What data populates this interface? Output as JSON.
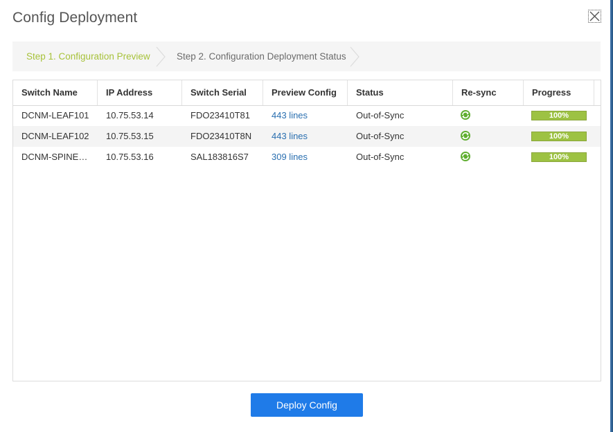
{
  "dialog": {
    "title": "Config Deployment"
  },
  "wizard": {
    "steps": [
      {
        "label": "Step 1. Configuration Preview",
        "active": true
      },
      {
        "label": "Step 2. Configuration Deployment Status",
        "active": false
      }
    ]
  },
  "table": {
    "columns": [
      "Switch Name",
      "IP Address",
      "Switch Serial",
      "Preview Config",
      "Status",
      "Re-sync",
      "Progress"
    ],
    "rows": [
      {
        "name": "DCNM-LEAF101",
        "ip": "10.75.53.14",
        "serial": "FDO23410T81",
        "preview": "443 lines",
        "status": "Out-of-Sync",
        "resync_icon": "resync-icon",
        "progress": 100,
        "progress_text": "100%"
      },
      {
        "name": "DCNM-LEAF102",
        "ip": "10.75.53.15",
        "serial": "FDO23410T8N",
        "preview": "443 lines",
        "status": "Out-of-Sync",
        "resync_icon": "resync-icon",
        "progress": 100,
        "progress_text": "100%"
      },
      {
        "name": "DCNM-SPINE…",
        "ip": "10.75.53.16",
        "serial": "SAL183816S7",
        "preview": "309 lines",
        "status": "Out-of-Sync",
        "resync_icon": "resync-icon",
        "progress": 100,
        "progress_text": "100%"
      }
    ]
  },
  "footer": {
    "deploy_label": "Deploy Config"
  },
  "colors": {
    "active_step": "#a7c23a",
    "link": "#2a6fb0",
    "progress": "#9dc243",
    "primary_button": "#1f7be8"
  }
}
